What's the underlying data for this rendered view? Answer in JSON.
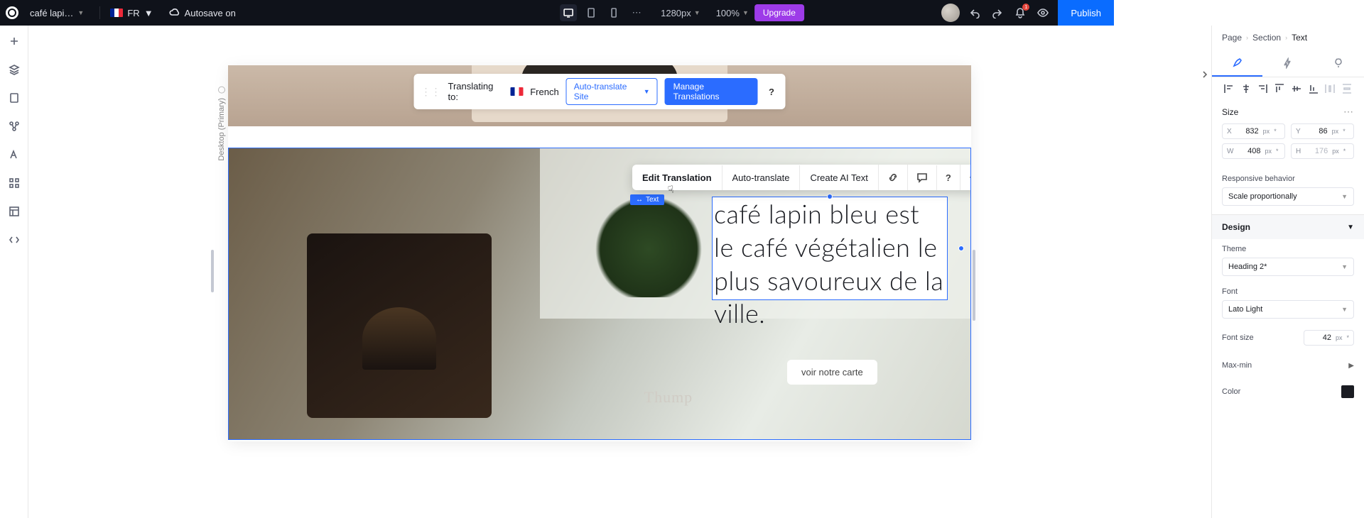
{
  "topbar": {
    "page_name": "café lapi…",
    "lang_code": "FR",
    "autosave": "Autosave on",
    "viewport": "1280px",
    "zoom": "100%",
    "upgrade": "Upgrade",
    "publish": "Publish",
    "notif_count": "1"
  },
  "translate_bar": {
    "prefix": "Translating to:",
    "lang": "French",
    "auto": "Auto-translate Site",
    "manage": "Manage Translations"
  },
  "breakpoint": "Desktop (Primary)",
  "context_toolbar": {
    "edit": "Edit Translation",
    "auto": "Auto-translate",
    "ai": "Create AI Text"
  },
  "selection_tag": "Text",
  "hero_text": "café lapin bleu est le café végétalien le plus savoureux de la ville.",
  "cta": "voir notre carte",
  "cafe_logo": "Thump",
  "panel": {
    "breadcrumbs": [
      "Page",
      "Section",
      "Text"
    ],
    "size_label": "Size",
    "x": "832",
    "y": "86",
    "w": "408",
    "h": "176",
    "unit": "px",
    "responsive_label": "Responsive behavior",
    "responsive_value": "Scale proportionally",
    "design": "Design",
    "theme_label": "Theme",
    "theme_value": "Heading 2*",
    "font_label": "Font",
    "font_value": "Lato Light",
    "fontsize_label": "Font size",
    "fontsize": "42",
    "maxmin": "Max-min",
    "color": "Color"
  }
}
